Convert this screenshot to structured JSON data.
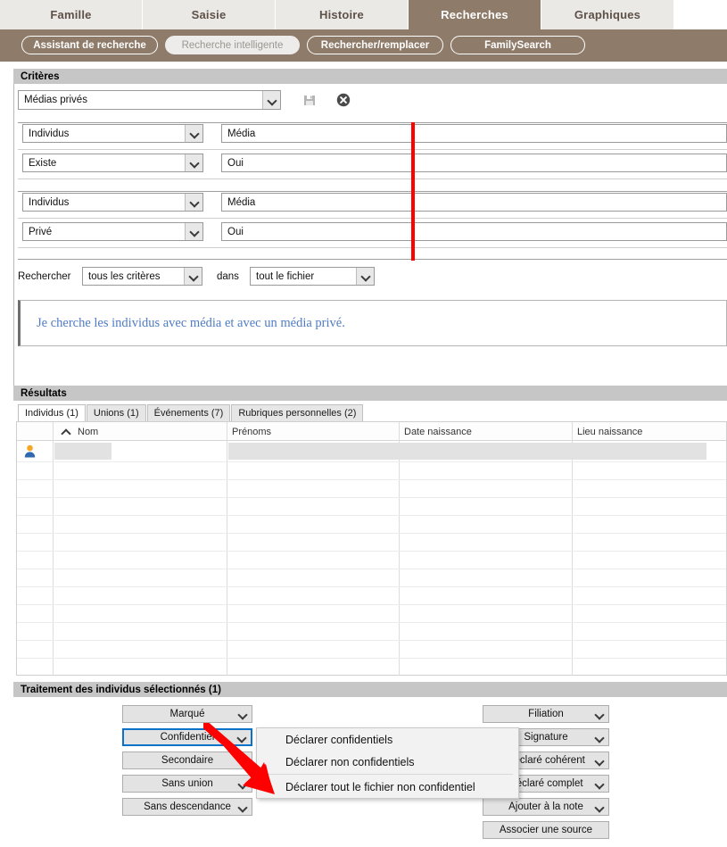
{
  "tabs": [
    {
      "label": "Famille",
      "active": false
    },
    {
      "label": "Saisie",
      "active": false
    },
    {
      "label": "Histoire",
      "active": false
    },
    {
      "label": "Recherches",
      "active": true
    },
    {
      "label": "Graphiques",
      "active": false
    }
  ],
  "toolbar": {
    "buttons": [
      {
        "label": "Assistant de recherche",
        "selected": false
      },
      {
        "label": "Recherche intelligente",
        "selected": true
      },
      {
        "label": "Rechercher/remplacer",
        "selected": false
      },
      {
        "label": "FamilySearch",
        "selected": false
      }
    ]
  },
  "criteria": {
    "header": "Critères",
    "preset": "Médias privés",
    "save_icon": "save-floppy-icon",
    "delete_icon": "delete-circle-x-icon",
    "groups": [
      {
        "subject": "Individus",
        "field": "Média",
        "operator": "Existe",
        "value": "Oui"
      },
      {
        "subject": "Individus",
        "field": "Média",
        "operator": "Privé",
        "value": "Oui"
      }
    ],
    "search_label": "Rechercher",
    "search_scope": "tous les critères",
    "in_label": "dans",
    "search_target": "tout le fichier",
    "description": "Je cherche les individus avec média et avec un média privé."
  },
  "results": {
    "header": "Résultats",
    "tabs": [
      {
        "label": "Individus (1)",
        "active": true
      },
      {
        "label": "Unions (1)",
        "active": false
      },
      {
        "label": "Événements (7)",
        "active": false
      },
      {
        "label": "Rubriques personnelles (2)",
        "active": false
      }
    ],
    "columns": [
      "Nom",
      "Prénoms",
      "Date naissance",
      "Lieu naissance"
    ],
    "sort_column": "Nom",
    "sort_direction": "ascending",
    "sort_icon": "chevron-up-icon",
    "rows": [
      {
        "icon": "person-icon",
        "nom": "",
        "prenoms": "",
        "date_naissance": "",
        "lieu_naissance": "",
        "redacted": true
      }
    ]
  },
  "processing": {
    "header": "Traitement des individus sélectionnés (1)",
    "left_buttons": [
      {
        "label": "Marqué",
        "focused": false
      },
      {
        "label": "Confidentiel",
        "focused": true
      },
      {
        "label": "Secondaire",
        "focused": false
      },
      {
        "label": "Sans union",
        "focused": false
      },
      {
        "label": "Sans descendance",
        "focused": false
      }
    ],
    "right_buttons": [
      {
        "label": "Filiation",
        "dropdown": true
      },
      {
        "label": "Signature",
        "dropdown": true
      },
      {
        "label": "Déclaré cohérent",
        "dropdown": true
      },
      {
        "label": "Déclaré complet",
        "dropdown": true
      },
      {
        "label": "Ajouter à la note",
        "dropdown": true
      },
      {
        "label": "Associer une source",
        "dropdown": false
      }
    ]
  },
  "context_menu": {
    "items": [
      {
        "label": "Déclarer confidentiels",
        "separator_after": false
      },
      {
        "label": "Déclarer non confidentiels",
        "separator_after": true
      },
      {
        "label": "Déclarer tout le fichier non confidentiel",
        "separator_after": false
      }
    ]
  },
  "annotations": {
    "vertical_line_color": "#ff0000",
    "arrow_color": "#ff0000"
  },
  "colors": {
    "brand_brown": "#8e7b69",
    "section_header": "#c6c6c6",
    "description_text": "#4f7cc4",
    "focus_blue": "#0a72c8"
  }
}
